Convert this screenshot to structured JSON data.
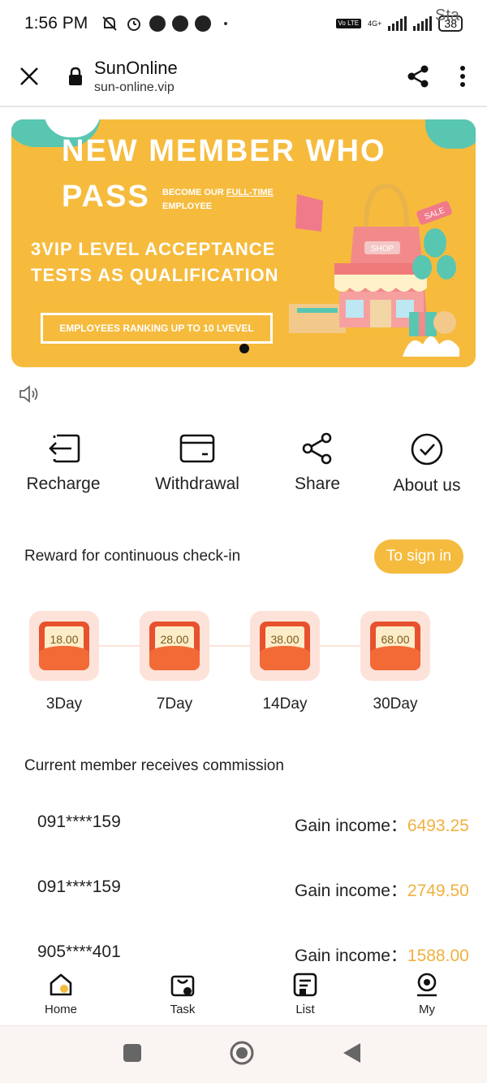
{
  "status_bar": {
    "time": "1:56 PM",
    "network": "4G+",
    "lte": "Vo LTE",
    "battery": "38"
  },
  "browser": {
    "title": "SunOnline",
    "url": "sun-online.vip"
  },
  "banner": {
    "line1": "NEW MEMBER WHO",
    "pass": "PASS",
    "sub_a": "BECOME OUR ",
    "sub_b": "FULL-TIME",
    "sub_c": "EMPLOYEE",
    "line3a": "3VIP LEVEL ACCEPTANCE",
    "line3b": "TESTS AS QUALIFICATION",
    "box": "EMPLOYEES RANKING UP TO 10 LVEVEL",
    "shop_sign": "SHOP",
    "sale_tag": "SALE"
  },
  "notice": {
    "text": "Sta"
  },
  "actions": [
    {
      "label": "Recharge",
      "icon": "recharge-icon"
    },
    {
      "label": "Withdrawal",
      "icon": "wallet-card-icon"
    },
    {
      "label": "Share",
      "icon": "share-icon"
    },
    {
      "label": "About us",
      "icon": "check-circle-icon"
    }
  ],
  "checkin": {
    "title": "Reward for continuous check-in",
    "button": "To sign in",
    "rewards": [
      {
        "amount": "18.00",
        "day": "3Day"
      },
      {
        "amount": "28.00",
        "day": "7Day"
      },
      {
        "amount": "38.00",
        "day": "14Day"
      },
      {
        "amount": "68.00",
        "day": "30Day"
      }
    ]
  },
  "commission": {
    "title": "Current member receives commission",
    "rows": [
      {
        "phone": "091****159",
        "label": "Gain income：",
        "amount": "6493.25"
      },
      {
        "phone": "091****159",
        "label": "Gain income：",
        "amount": "2749.50"
      },
      {
        "phone": "905****401",
        "label": "Gain income：",
        "amount": "1588.00"
      }
    ]
  },
  "tabs": [
    {
      "label": "Home",
      "icon": "home-icon"
    },
    {
      "label": "Task",
      "icon": "task-bag-icon"
    },
    {
      "label": "List",
      "icon": "list-icon"
    },
    {
      "label": "My",
      "icon": "profile-icon"
    }
  ],
  "colors": {
    "accent": "#f5bb3e",
    "banner": "#f6bb3d",
    "teal": "#59c6b1",
    "envelope": "#e8512d",
    "amount": "#f0b13f"
  }
}
